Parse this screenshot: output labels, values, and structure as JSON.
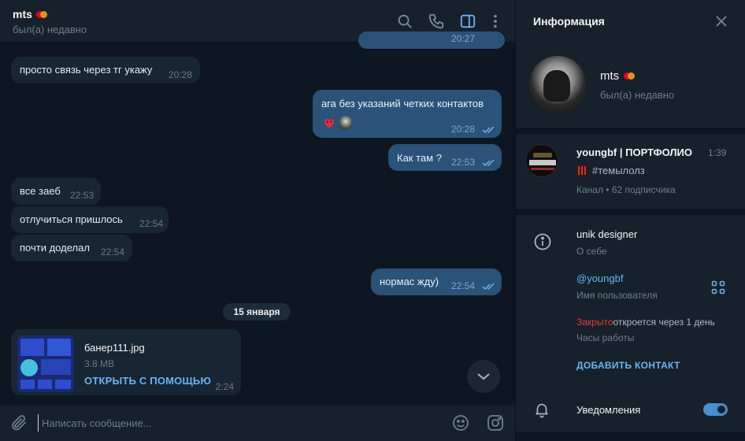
{
  "chat": {
    "title": "mts",
    "status": "был(а) недавно",
    "header_icons": [
      "search-icon",
      "phone-icon",
      "sidebar-toggle-icon",
      "more-vertical-icon"
    ]
  },
  "messages": [
    {
      "dir": "in",
      "text": "просто связь через тг укажу",
      "time": "20:28"
    },
    {
      "dir": "out",
      "text": "ага без указаний четких контактов",
      "time": "20:28",
      "reactions": [
        "heart-reaction",
        "avatar-reaction"
      ],
      "read": true
    },
    {
      "dir": "out",
      "text": "Как там ?",
      "time": "22:53",
      "read": true
    },
    {
      "dir": "in",
      "text": "все заеб",
      "time": "22:53"
    },
    {
      "dir": "in",
      "text": "отлучиться пришлось",
      "time": "22:54"
    },
    {
      "dir": "in",
      "text": "почти доделал",
      "time": "22:54"
    },
    {
      "dir": "out",
      "text": "нормас жду)",
      "time": "22:54",
      "read": true
    }
  ],
  "date_separator": "15 января",
  "file_message": {
    "name": "банер111.jpg",
    "size": "3.8 MB",
    "action": "ОТКРЫТЬ С ПОМОЩЬЮ",
    "time": "2:24"
  },
  "composer": {
    "placeholder": "Написать сообщение..."
  },
  "info": {
    "title": "Информация",
    "profile": {
      "name": "mts",
      "status": "был(а) недавно"
    },
    "channel": {
      "name": "youngbf | ПОРТФОЛИО",
      "time": "1:39",
      "tag": "#темылолз",
      "subtitle": "Канал • 62 подписчика"
    },
    "bio": {
      "value": "unik designer",
      "label": "О себе"
    },
    "username": {
      "value": "@youngbf",
      "label": "Имя пользователя"
    },
    "hours": {
      "closed": "Закрыто",
      "opens": "откроется через 1 день",
      "label": "Часы работы"
    },
    "add_contact": "ДОБАВИТЬ КОНТАКТ",
    "notifications": {
      "label": "Уведомления",
      "enabled": true
    }
  },
  "colors": {
    "background": "#0e1621",
    "panel": "#17212b",
    "incoming_bubble": "#182533",
    "outgoing_bubble": "#2b5278",
    "accent": "#6ab3f3",
    "closed_red": "#e53935"
  }
}
